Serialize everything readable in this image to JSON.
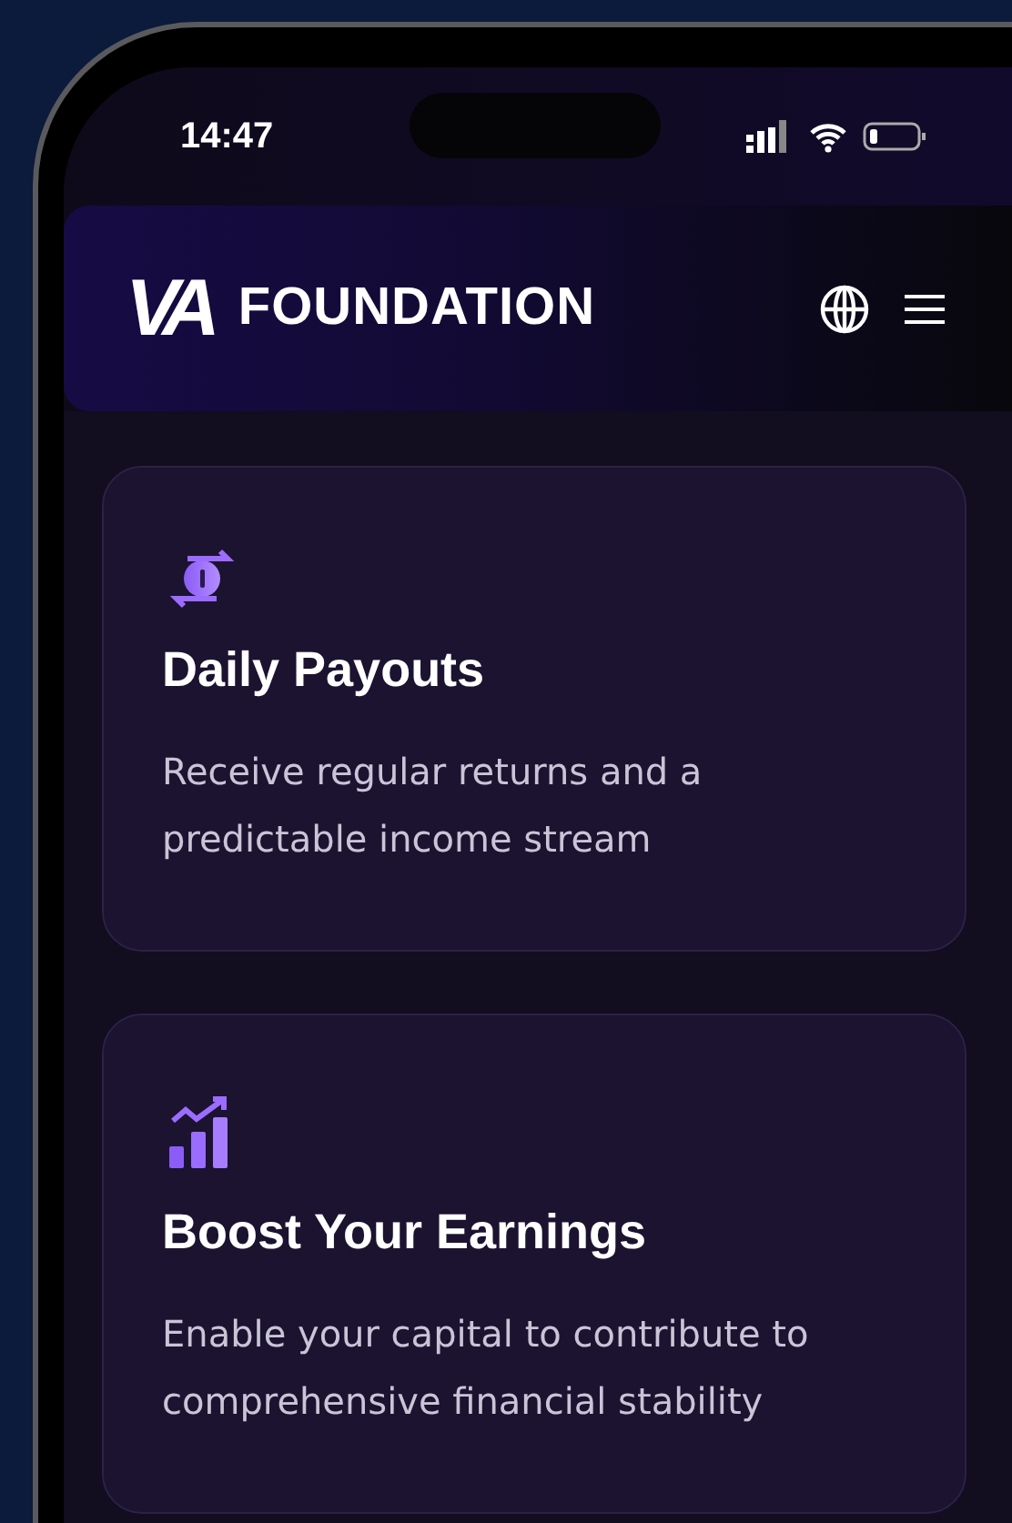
{
  "status_bar": {
    "time": "14:47"
  },
  "header": {
    "logo_mark": "VA",
    "brand": "FOUNDATION"
  },
  "cards": [
    {
      "kind": "payouts",
      "title": "Daily Payouts",
      "text": "Receive regular returns and a predictable income stream"
    },
    {
      "kind": "growth",
      "title": "Boost Your Earnings",
      "text": "Enable your capital to contribute to comprehensive financial stability"
    }
  ]
}
